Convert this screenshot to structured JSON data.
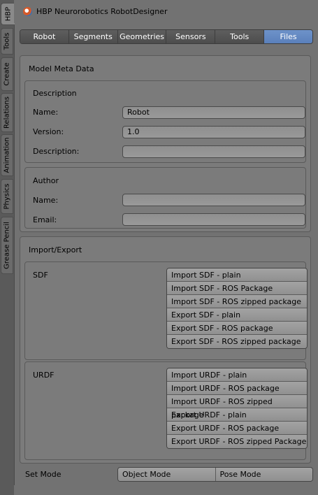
{
  "vertical_tabs": [
    "HBP",
    "Tools",
    "Create",
    "Relations",
    "Animation",
    "Physics",
    "Grease Pencil"
  ],
  "header": {
    "title": "HBP Neurorobotics RobotDesigner",
    "icon": "blender-logo-icon"
  },
  "top_tabs": [
    "Robot",
    "Segments",
    "Geometries",
    "Sensors",
    "Tools",
    "Files"
  ],
  "active_top_tab": "Files",
  "model_meta": {
    "title": "Model Meta Data",
    "description_box": {
      "title": "Description",
      "name_label": "Name:",
      "name_value": "Robot",
      "version_label": "Version:",
      "version_value": "1.0",
      "description_label": "Description:",
      "description_value": ""
    },
    "author_box": {
      "title": "Author",
      "name_label": "Name:",
      "name_value": "",
      "email_label": "Email:",
      "email_value": ""
    }
  },
  "import_export": {
    "title": "Import/Export",
    "sdf": {
      "label": "SDF",
      "buttons": [
        "Import SDF - plain",
        "Import SDF - ROS Package",
        "Import SDF - ROS zipped package",
        "Export SDF - plain",
        "Export SDF - ROS package",
        "Export SDF - ROS zipped package"
      ]
    },
    "urdf": {
      "label": "URDF",
      "buttons": [
        "Import URDF - plain",
        "Import URDF - ROS package",
        "Import URDF - ROS zipped package",
        "Export URDF - plain",
        "Export URDF - ROS package",
        "Export URDF - ROS zipped Package"
      ]
    }
  },
  "set_mode": {
    "label": "Set Mode",
    "modes": [
      "Object Mode",
      "Pose Mode"
    ]
  },
  "colors": {
    "active_tab": "#5a80bb",
    "panel_bg": "#7b7b7b",
    "window_bg": "#727272"
  }
}
